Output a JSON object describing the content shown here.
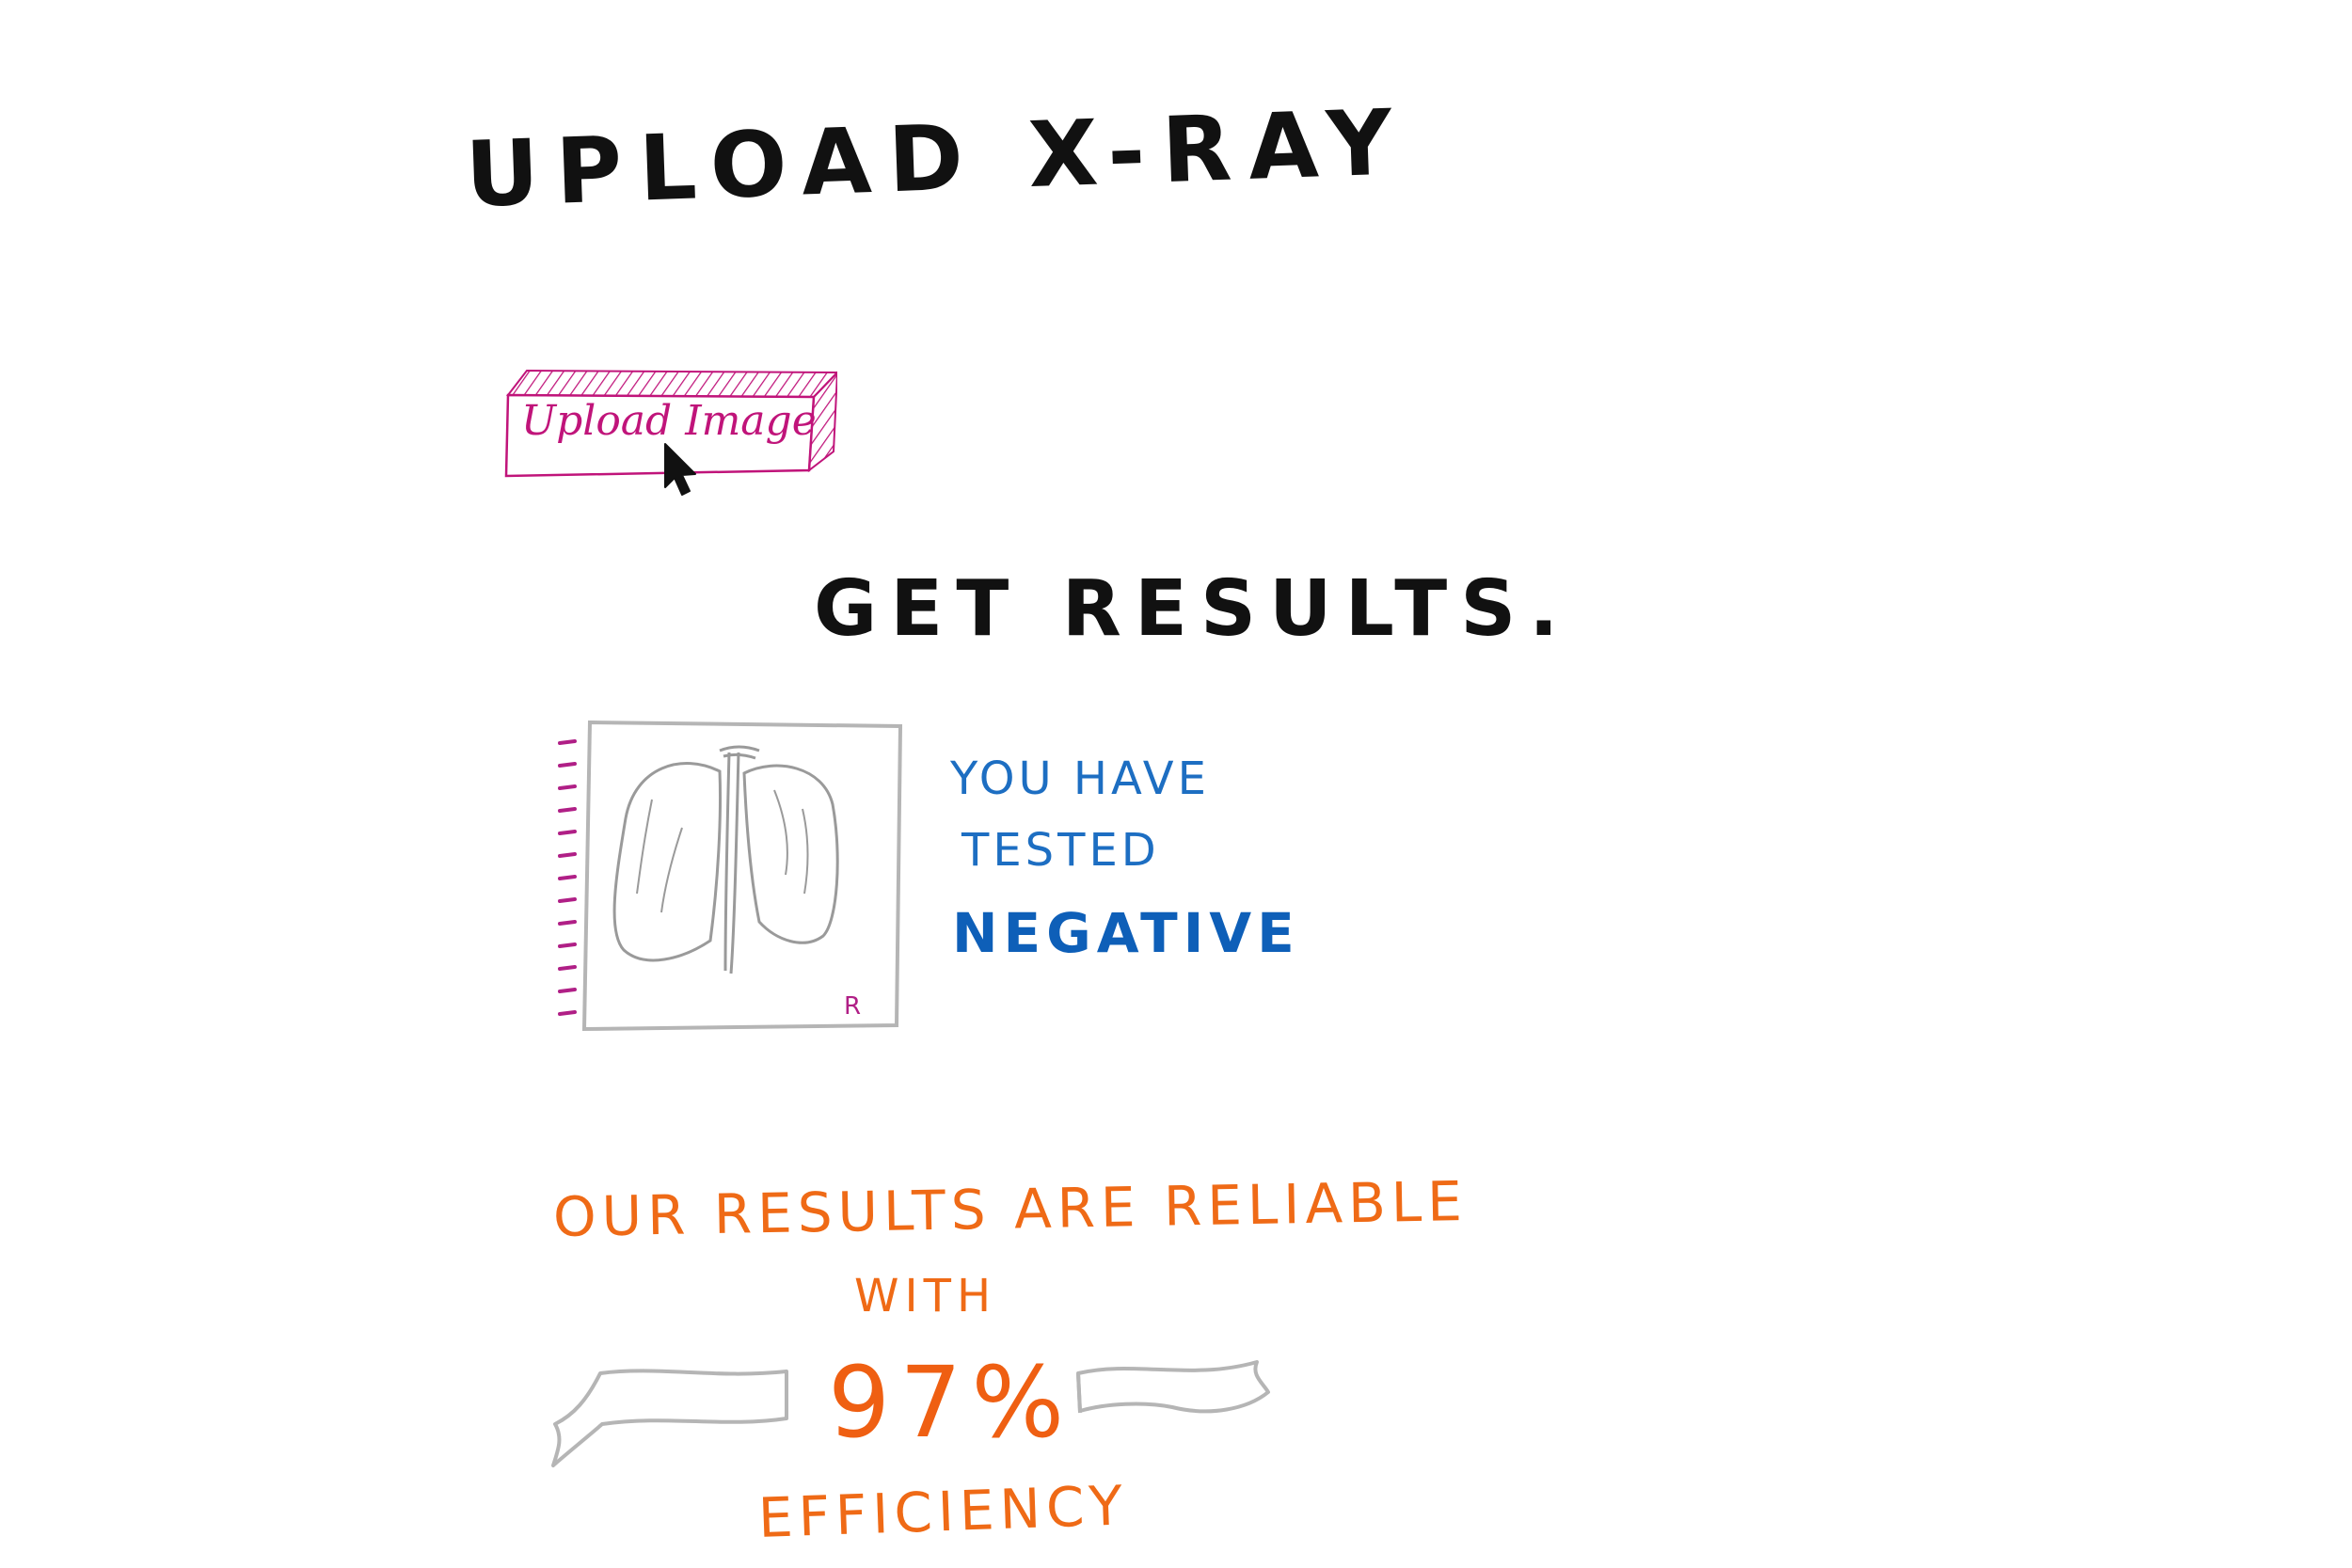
{
  "header": {
    "title": "UPLOAD X-RAY"
  },
  "upload": {
    "button_label": "Upload Image",
    "accent_color": "#c0147a"
  },
  "results": {
    "title": "GET RESULTS.",
    "message_line_1": "YOU HAVE",
    "message_line_2": "TESTED",
    "outcome": "NEGATIVE",
    "text_color": "#1d6ec2",
    "xray_marker": "R"
  },
  "reliability": {
    "line_1": "OUR RESULTS ARE RELIABLE",
    "line_2": "WITH",
    "efficiency_percent": "97%",
    "efficiency_label": "EFFICIENCY",
    "text_color": "#ef6a16"
  },
  "icons": {
    "cursor": "cursor-arrow-icon",
    "xray": "lungs-xray-icon",
    "ribbon": "banner-ribbon-icon"
  }
}
